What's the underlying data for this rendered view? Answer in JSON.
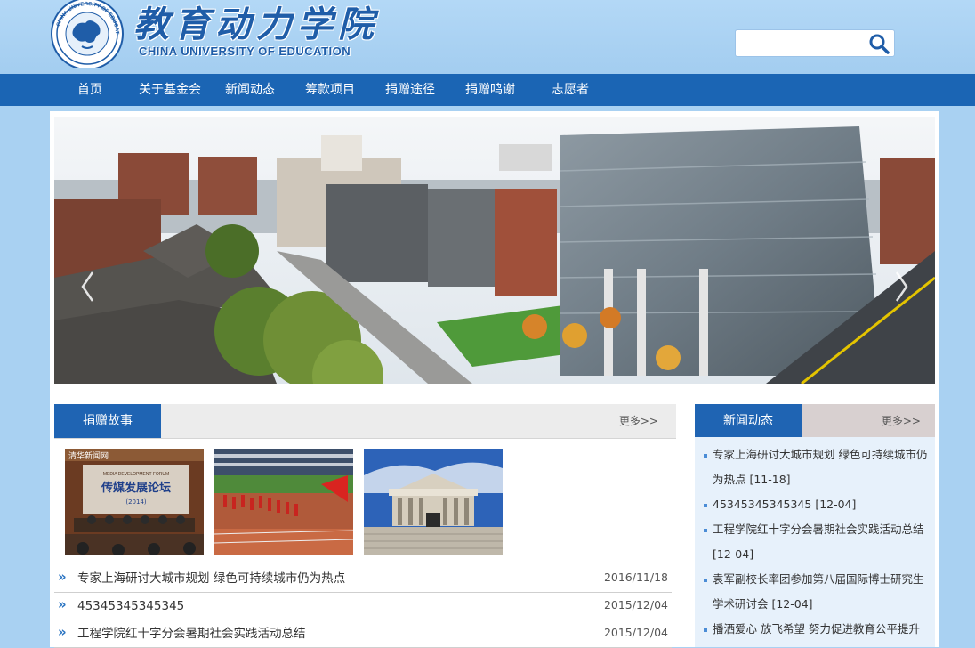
{
  "site": {
    "title_cn": "教育动力学院",
    "title_en": "CHINA UNIVERSITY OF EDUCATION",
    "seal_text": "CHINA UNIVERSITY OF EDUCATION"
  },
  "search": {
    "value": "",
    "placeholder": "",
    "icon": "search-icon"
  },
  "nav": {
    "items": [
      {
        "label": "首页"
      },
      {
        "label": "关于基金会"
      },
      {
        "label": "新闻动态"
      },
      {
        "label": "筹款项目"
      },
      {
        "label": "捐赠途径"
      },
      {
        "label": "捐赠鸣谢"
      },
      {
        "label": "志愿者"
      }
    ]
  },
  "banner": {
    "prev_icon": "chevron-left-icon",
    "next_icon": "chevron-right-icon"
  },
  "stories": {
    "title": "捐赠故事",
    "more": "更多>>",
    "thumbs": [
      {
        "caption_top": "清华新闻网",
        "caption_sub": "MEDIA DEVELOPMENT FORUM",
        "caption_main": "传媒发展论坛",
        "caption_year": "(2014)"
      },
      {
        "caption_top": ""
      },
      {
        "caption_top": ""
      }
    ],
    "items": [
      {
        "title": "专家上海研讨大城市规划 绿色可持续城市仍为热点",
        "date": "2016/11/18"
      },
      {
        "title": "45345345345345",
        "date": "2015/12/04"
      },
      {
        "title": "工程学院红十字分会暑期社会实践活动总结",
        "date": "2015/12/04"
      }
    ]
  },
  "news": {
    "title": "新闻动态",
    "more": "更多>>",
    "items": [
      {
        "text": "专家上海研讨大城市规划 绿色可持续城市仍为热点 [11-18]"
      },
      {
        "text": "45345345345345 [12-04]"
      },
      {
        "text": "工程学院红十字分会暑期社会实践活动总结 [12-04]"
      },
      {
        "text": "袁军副校长率团参加第八届国际博士研究生学术研讨会 [12-04]"
      },
      {
        "text": "播洒爱心 放飞希望 努力促进教育公平提升教"
      }
    ]
  },
  "colors": {
    "header_bg": "#a9d1f2",
    "nav_bg": "#1b65b4",
    "accent": "#1f64b3",
    "news_bg": "#e7f1fb"
  }
}
